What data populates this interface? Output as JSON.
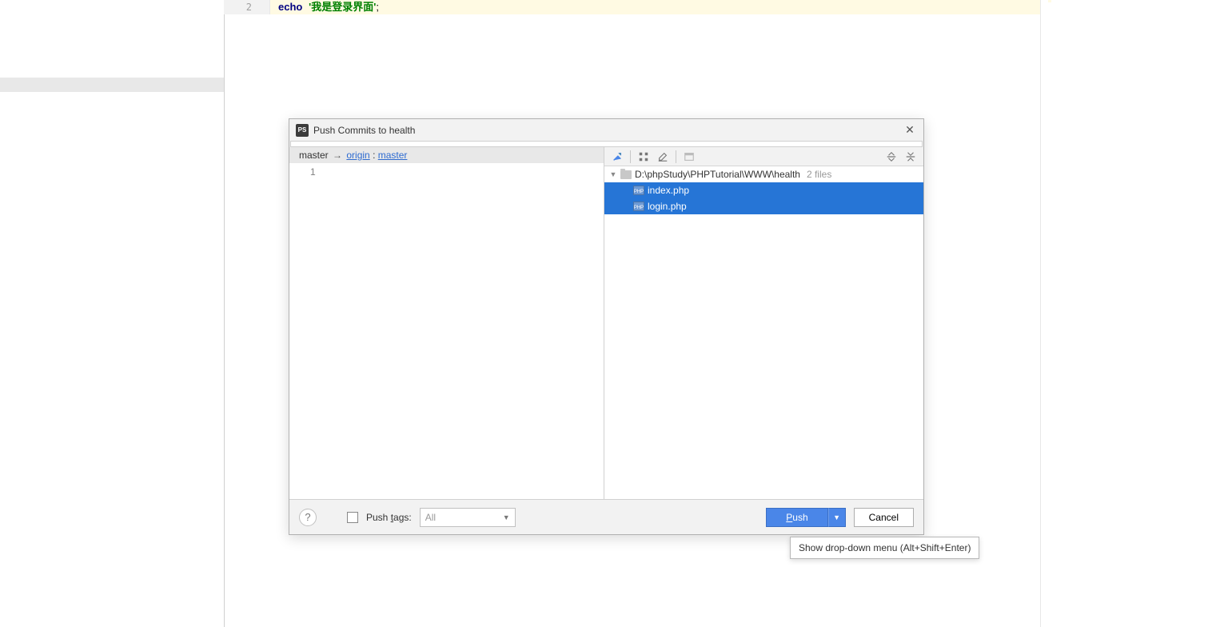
{
  "editor": {
    "line_number": "2",
    "keyword": "echo",
    "string_literal": "'我是登录界面'",
    "semicolon": ";"
  },
  "dialog": {
    "title": "Push Commits to health",
    "branch": {
      "local": "master",
      "remote_name": "origin",
      "colon": " : ",
      "remote_branch": "master"
    },
    "commit_count": "1",
    "tree": {
      "root_path": "D:\\phpStudy\\PHPTutorial\\WWW\\health",
      "root_suffix": "2 files",
      "files": [
        "index.php",
        "login.php"
      ]
    },
    "footer": {
      "help": "?",
      "push_tags_prefix": "Push ",
      "push_tags_ul": "t",
      "push_tags_suffix": "ags:",
      "combo_value": "All",
      "push_ul": "P",
      "push_suffix": "ush",
      "cancel": "Cancel"
    }
  },
  "tooltip": "Show drop-down menu (Alt+Shift+Enter)"
}
